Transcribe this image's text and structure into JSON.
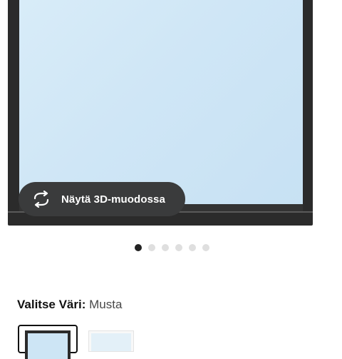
{
  "product_gallery": {
    "view_3d_label": "Näytä 3D-muodossa",
    "view_3d_icon": "rotate-3d-icon",
    "image_count": 6,
    "active_image": 1
  },
  "color_selector": {
    "heading_label": "Valitse Väri:",
    "selected_value": "Musta",
    "options": [
      "black",
      "white"
    ]
  }
}
